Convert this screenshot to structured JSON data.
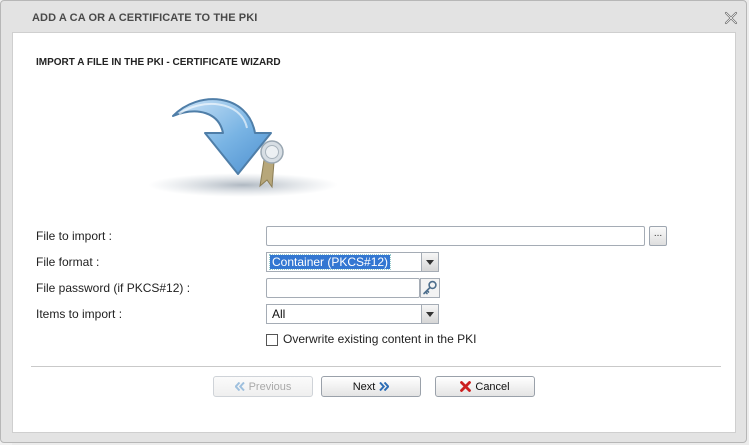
{
  "dialog": {
    "title": "ADD A CA OR A CERTIFICATE TO THE PKI",
    "close_icon": "close-icon"
  },
  "wizard": {
    "title": "IMPORT A FILE IN THE PKI - CERTIFICATE WIZARD",
    "illustration_icon": "import-certificate-icon"
  },
  "form": {
    "file_to_import": {
      "label": "File to import :",
      "value": "",
      "browse_label": "..."
    },
    "file_format": {
      "label": "File format :",
      "selected": "Container (PKCS#12)"
    },
    "file_password": {
      "label": "File password (if PKCS#12) :",
      "value": "",
      "icon": "key-icon"
    },
    "items_to_import": {
      "label": "Items to import :",
      "selected": "All"
    },
    "overwrite": {
      "label": "Overwrite existing content in the PKI",
      "checked": false
    }
  },
  "buttons": {
    "previous": {
      "label": "Previous",
      "enabled": false
    },
    "next": {
      "label": "Next",
      "enabled": true
    },
    "cancel": {
      "label": "Cancel",
      "enabled": true
    }
  },
  "colors": {
    "selection": "#3377d2",
    "arrow_blue": "#5a9fd8",
    "cancel_red": "#cc1f1f"
  }
}
